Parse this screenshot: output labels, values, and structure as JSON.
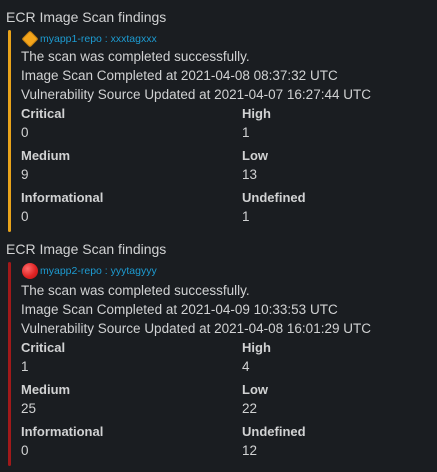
{
  "messages": [
    {
      "title": "ECR Image Scan findings",
      "status_icon": "orange-diamond-icon",
      "status_color": "#f4a51c",
      "bar_color": "#e8a31b",
      "repo": "myapp1-repo : xxxtagxxx",
      "summary": "The scan was completed successfully.",
      "scan_completed": "Image Scan Completed at 2021-04-08 08:37:32 UTC",
      "source_updated": "Vulnerability Source Updated at 2021-04-07 16:27:44 UTC",
      "fields": {
        "critical_label": "Critical",
        "critical": "0",
        "high_label": "High",
        "high": "1",
        "medium_label": "Medium",
        "medium": "9",
        "low_label": "Low",
        "low": "13",
        "informational_label": "Informational",
        "informational": "0",
        "undefined_label": "Undefined",
        "undefined": "1"
      }
    },
    {
      "title": "ECR Image Scan findings",
      "status_icon": "red-circle-icon",
      "status_color": "#e02424",
      "bar_color": "#a0191a",
      "repo": "myapp2-repo : yyytagyyy",
      "summary": "The scan was completed successfully.",
      "scan_completed": "Image Scan Completed at 2021-04-09 10:33:53 UTC",
      "source_updated": "Vulnerability Source Updated at 2021-04-08 16:01:29 UTC",
      "fields": {
        "critical_label": "Critical",
        "critical": "1",
        "high_label": "High",
        "high": "4",
        "medium_label": "Medium",
        "medium": "25",
        "low_label": "Low",
        "low": "22",
        "informational_label": "Informational",
        "informational": "0",
        "undefined_label": "Undefined",
        "undefined": "12"
      }
    }
  ]
}
